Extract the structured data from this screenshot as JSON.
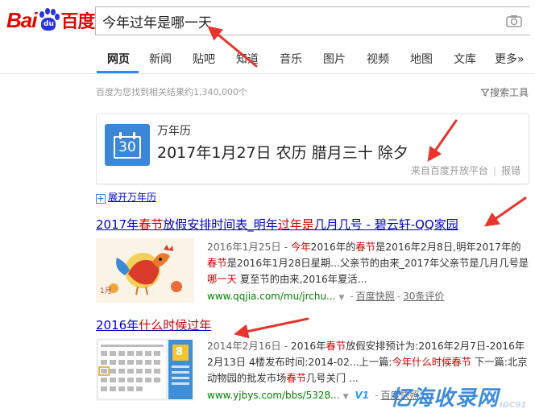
{
  "logo": {
    "bai": "Bai",
    "du": "du",
    "baidu_cn": "百度"
  },
  "search": {
    "query": "今年过年是哪一天"
  },
  "tabs": [
    {
      "label": "网页"
    },
    {
      "label": "新闻"
    },
    {
      "label": "贴吧"
    },
    {
      "label": "知道"
    },
    {
      "label": "音乐"
    },
    {
      "label": "图片"
    },
    {
      "label": "视频"
    },
    {
      "label": "地图"
    },
    {
      "label": "文库"
    },
    {
      "label": "更多»"
    }
  ],
  "result_count": "百度为您找到相关结果约1,340,000个",
  "search_tools": "搜索工具",
  "calendar": {
    "icon_day": "30",
    "title": "万年历",
    "date": "2017年1月27日 农历 腊月三十 除夕",
    "source": "来自百度开放平台",
    "report": "报错"
  },
  "expand": {
    "plus": "+",
    "label": "展开万年历"
  },
  "results": [
    {
      "title_parts": [
        "2017年",
        "春节",
        "放假安排时间表_明年",
        "过年",
        "是",
        "几月几号 - 碧云轩-QQ家园"
      ],
      "date": "2016年1月25日 - ",
      "abstract_parts": [
        "今年",
        "2016年的",
        "春节",
        "是2016年2月8日,明年2017年的",
        "春节",
        "是2016年1月28日星期...父亲节的由来_2017年父亲节是几月几号是",
        "哪一天",
        " 夏至节的由来,2016年夏活..."
      ],
      "url": "www.qqjia.com/mu/jrchu...",
      "snapshot": "百度快照",
      "comments": "30条评价",
      "thumb_caption": "1月"
    },
    {
      "title_parts": [
        "2016年",
        "什么时候",
        "过年"
      ],
      "date": "2014年2月16日 - ",
      "abstract_parts": [
        "2016年",
        "春节",
        "放假安排预计为:2016年2月7日-2016年2月13日 4楼发布时间:2014-02...上一篇:",
        "今年什么时候春节",
        " 下一篇:北京动物园的批发市场",
        "春节",
        "几号关门 ..."
      ],
      "url": "www.yjbys.com/bbs/5328...",
      "v1": "V1",
      "snapshot": "百度快照",
      "thumb_day": "8"
    }
  ],
  "watermark": {
    "main": "忆海收录网",
    "small": "IDC91"
  },
  "colors": {
    "link": "#0000cc",
    "highlight": "#cc0000",
    "url": "#008000",
    "tab_active": "#3385ff",
    "brand_red": "#e10601",
    "brand_blue": "#2932e1",
    "annotation": "#e8342c"
  }
}
